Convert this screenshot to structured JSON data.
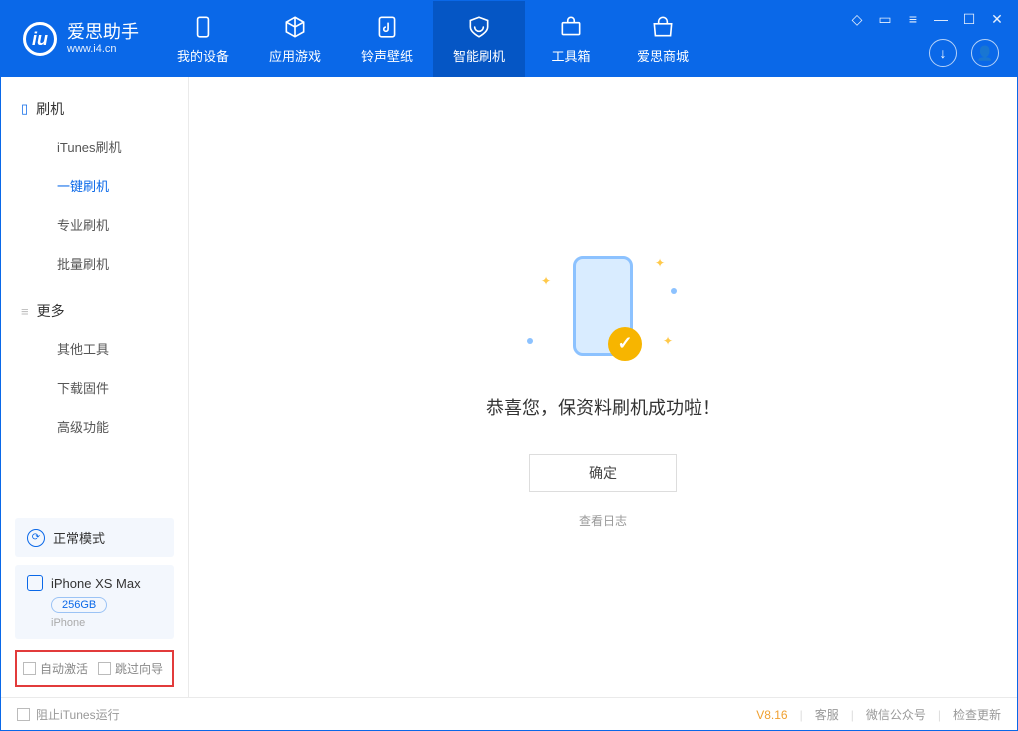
{
  "app": {
    "name": "爱思助手",
    "url": "www.i4.cn"
  },
  "tabs": [
    {
      "label": "我的设备"
    },
    {
      "label": "应用游戏"
    },
    {
      "label": "铃声壁纸"
    },
    {
      "label": "智能刷机"
    },
    {
      "label": "工具箱"
    },
    {
      "label": "爱思商城"
    }
  ],
  "sidebar": {
    "section1": {
      "title": "刷机",
      "items": [
        "iTunes刷机",
        "一键刷机",
        "专业刷机",
        "批量刷机"
      ]
    },
    "section2": {
      "title": "更多",
      "items": [
        "其他工具",
        "下载固件",
        "高级功能"
      ]
    },
    "mode": "正常模式",
    "device": {
      "name": "iPhone XS Max",
      "storage": "256GB",
      "type": "iPhone"
    },
    "checkbox1": "自动激活",
    "checkbox2": "跳过向导"
  },
  "main": {
    "success": "恭喜您，保资料刷机成功啦！",
    "confirm": "确定",
    "log_link": "查看日志"
  },
  "footer": {
    "block_itunes": "阻止iTunes运行",
    "version": "V8.16",
    "support": "客服",
    "wechat": "微信公众号",
    "update": "检查更新"
  }
}
